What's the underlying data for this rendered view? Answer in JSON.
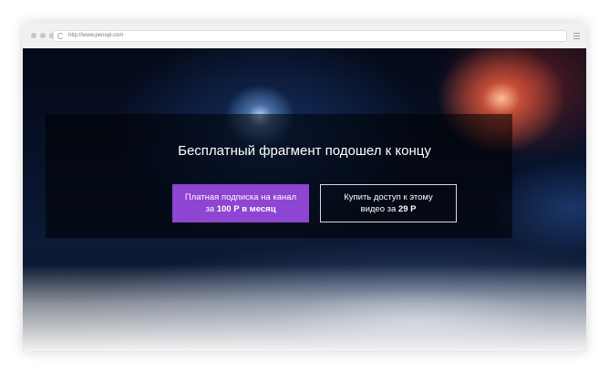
{
  "browser": {
    "url": "http://www.penopl.com",
    "icons": {
      "reload": "reload-icon",
      "menu": "hamburger-menu-icon"
    }
  },
  "overlay": {
    "headline": "Бесплатный фрагмент подошел к концу",
    "subscribe_button": {
      "line1": "Платная подписка на канал",
      "line2_prefix": "за ",
      "line2_bold": "100 Р в месяц"
    },
    "buy_button": {
      "line1": "Купить доступ к этому",
      "line2_prefix": "видео за ",
      "line2_bold": "29 Р"
    }
  },
  "colors": {
    "accent": "#8e45d1",
    "button_border": "#d9d9d9"
  }
}
